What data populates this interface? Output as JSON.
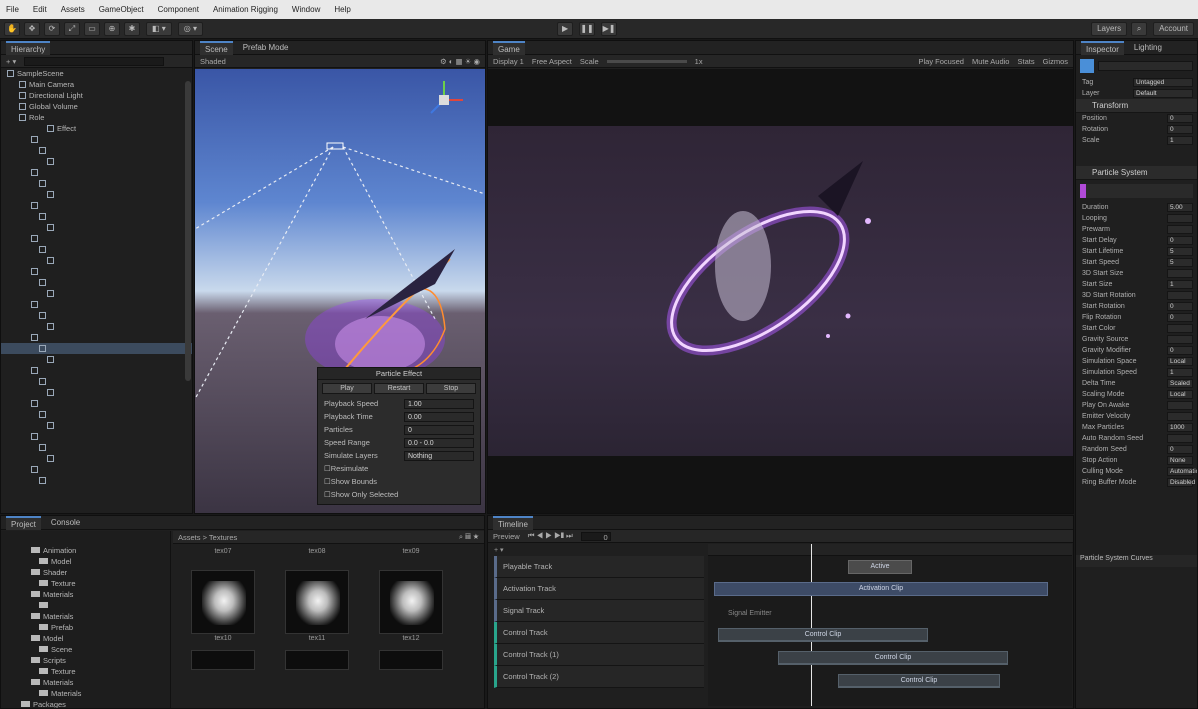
{
  "menu": [
    "File",
    "Edit",
    "Assets",
    "GameObject",
    "Component",
    "Animation Rigging",
    "Window",
    "Help"
  ],
  "toolbar": {
    "play_icon": "play-icon",
    "pause_icon": "pause-icon",
    "step_icon": "step-icon",
    "layers_label": "Layers",
    "account_label": "Account"
  },
  "hierarchy": {
    "tab": "Hierarchy",
    "rows": [
      "SampleScene",
      "Main Camera",
      "Directional Light",
      "Global Volume",
      "Role",
      "Effect",
      "",
      "",
      "",
      "",
      "",
      "",
      "",
      "",
      "",
      "",
      "",
      "",
      "",
      "",
      "",
      "",
      "",
      "",
      "",
      "",
      "",
      "",
      "",
      "",
      "",
      "",
      "",
      "",
      "",
      "",
      "",
      ""
    ]
  },
  "scene": {
    "tab": "Scene",
    "tab2": "Prefab Mode",
    "mode": "Shaded"
  },
  "particle_popup": {
    "title": "Particle Effect",
    "buttons": [
      "Play",
      "Restart",
      "Stop"
    ],
    "rows": [
      {
        "label": "Playback Speed",
        "value": "1.00"
      },
      {
        "label": "Playback Time",
        "value": "0.00"
      },
      {
        "label": "Particles",
        "value": "0"
      },
      {
        "label": "Speed Range",
        "value": "0.0 - 0.0"
      },
      {
        "label": "Simulate Layers",
        "value": "Nothing"
      }
    ],
    "checks": [
      "Resimulate",
      "Show Bounds",
      "Show Only Selected"
    ]
  },
  "game": {
    "tab": "Game",
    "display": "Display 1",
    "resolution": "Free Aspect",
    "scale_label": "Scale",
    "scale_value": "1x",
    "play_focused": "Play Focused",
    "mute": "Mute Audio",
    "stats": "Stats",
    "gizmos": "Gizmos"
  },
  "inspector": {
    "tabs": [
      "Inspector",
      "Lighting"
    ],
    "object_name": "",
    "tag_label": "Tag",
    "tag_value": "Untagged",
    "layer_label": "Layer",
    "layer_value": "Default",
    "transform_header": "Transform",
    "transform_rows": [
      {
        "label": "Position",
        "value": "0"
      },
      {
        "label": "Rotation",
        "value": "0"
      },
      {
        "label": "Scale",
        "value": "1"
      }
    ],
    "ps_header": "Particle System",
    "ps_rows": [
      {
        "label": "Duration",
        "value": "5.00"
      },
      {
        "label": "Looping",
        "value": ""
      },
      {
        "label": "Prewarm",
        "value": ""
      },
      {
        "label": "Start Delay",
        "value": "0"
      },
      {
        "label": "Start Lifetime",
        "value": "5"
      },
      {
        "label": "Start Speed",
        "value": "5"
      },
      {
        "label": "3D Start Size",
        "value": ""
      },
      {
        "label": "Start Size",
        "value": "1"
      },
      {
        "label": "3D Start Rotation",
        "value": ""
      },
      {
        "label": "Start Rotation",
        "value": "0"
      },
      {
        "label": "Flip Rotation",
        "value": "0"
      },
      {
        "label": "Start Color",
        "value": ""
      },
      {
        "label": "Gravity Source",
        "value": ""
      },
      {
        "label": "Gravity Modifier",
        "value": "0"
      },
      {
        "label": "Simulation Space",
        "value": "Local"
      },
      {
        "label": "Simulation Speed",
        "value": "1"
      },
      {
        "label": "Delta Time",
        "value": "Scaled"
      },
      {
        "label": "Scaling Mode",
        "value": "Local"
      },
      {
        "label": "Play On Awake",
        "value": ""
      },
      {
        "label": "Emitter Velocity",
        "value": ""
      },
      {
        "label": "Max Particles",
        "value": "1000"
      },
      {
        "label": "Auto Random Seed",
        "value": ""
      },
      {
        "label": "Random Seed",
        "value": "0"
      },
      {
        "label": "Stop Action",
        "value": "None"
      },
      {
        "label": "Culling Mode",
        "value": "Automatic"
      },
      {
        "label": "Ring Buffer Mode",
        "value": "Disabled"
      }
    ],
    "footer": "Particle System Curves"
  },
  "project": {
    "tabs": [
      "Project",
      "Console"
    ],
    "breadcrumb": "Assets > Textures",
    "folders": [
      "Animation",
      "Model",
      "Shader",
      "Texture",
      "Materials",
      "",
      "Materials",
      "Prefab",
      "Model",
      "Scene",
      "Scripts",
      "Texture",
      "Materials",
      "Materials",
      "Packages"
    ],
    "top_labels": [
      "tex07",
      "tex08",
      "tex09"
    ],
    "thumb_labels": [
      "tex10",
      "tex11",
      "tex12"
    ]
  },
  "timeline": {
    "tab": "Timeline",
    "preview_label": "Preview",
    "frame_value": "0",
    "tracks": [
      "Playable Track",
      "Activation Track",
      "Signal Track",
      "Control Track",
      "Control Track (1)",
      "Control Track (2)"
    ],
    "clips": [
      "Active",
      "Activation Clip",
      "Signal Emitter",
      "Control Clip",
      "Control Clip",
      "Control Clip"
    ]
  },
  "colors": {
    "accent": "#4e84c6",
    "teal": "#2fc2b2",
    "purple_glow": "#b15cff"
  }
}
